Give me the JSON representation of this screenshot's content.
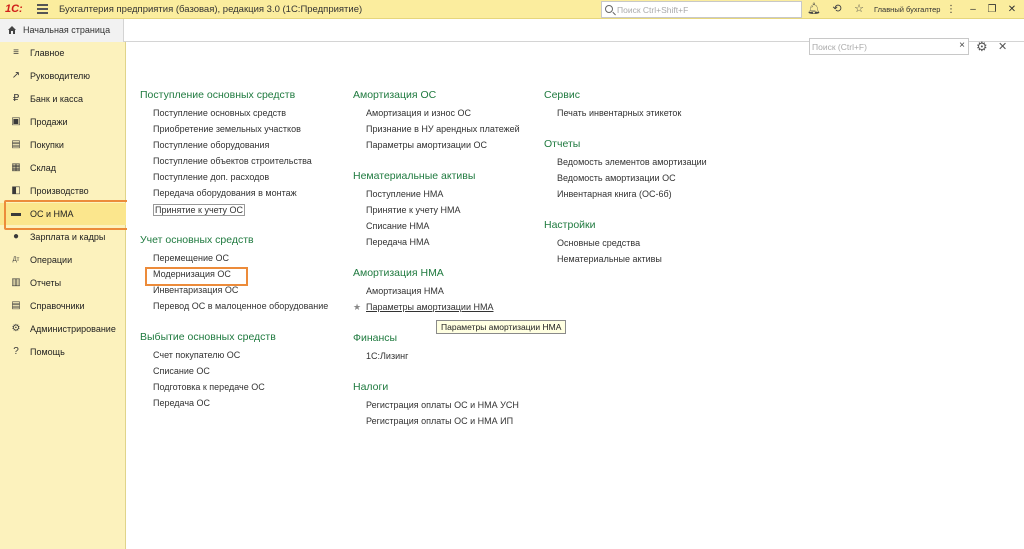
{
  "titlebar": {
    "logo": "1С:",
    "title": "Бухгалтерия предприятия (базовая), редакция 3.0  (1С:Предприятие)",
    "search_placeholder": "Поиск Ctrl+Shift+F",
    "username": "Главный бухгалтер",
    "icons": [
      "bell-icon",
      "history-icon",
      "star-icon",
      "username",
      "more-icon",
      "minimize-icon",
      "maximize-icon",
      "close-icon"
    ]
  },
  "tabstrip": {
    "home_label": "Начальная страница"
  },
  "sidebar": {
    "items": [
      {
        "label": "Главное",
        "icon": "≡"
      },
      {
        "label": "Руководителю",
        "icon": "↗"
      },
      {
        "label": "Банк и касса",
        "icon": "₽"
      },
      {
        "label": "Продажи",
        "icon": "▣"
      },
      {
        "label": "Покупки",
        "icon": "▤"
      },
      {
        "label": "Склад",
        "icon": "▦"
      },
      {
        "label": "Производство",
        "icon": "◧"
      },
      {
        "label": "ОС и НМА",
        "icon": "▬"
      },
      {
        "label": "Зарплата и кадры",
        "icon": "●"
      },
      {
        "label": "Операции",
        "icon": "Дт"
      },
      {
        "label": "Отчеты",
        "icon": "▥"
      },
      {
        "label": "Справочники",
        "icon": "▤"
      },
      {
        "label": "Администрирование",
        "icon": "⚙"
      },
      {
        "label": "Помощь",
        "icon": "?"
      }
    ],
    "active_index": 7
  },
  "main": {
    "search_placeholder": "Поиск (Ctrl+F)",
    "columns": [
      {
        "groups": [
          {
            "title": "Поступление основных средств",
            "links": [
              "Поступление основных средств",
              "Приобретение земельных участков",
              "Поступление оборудования",
              "Поступление объектов строительства",
              "Поступление доп. расходов",
              "Передача оборудования в монтаж",
              "Принятие к учету ОС"
            ]
          },
          {
            "title": "Учет основных средств",
            "links": [
              "Перемещение ОС",
              "Модернизация ОС",
              "Инвентаризация ОС",
              "Перевод ОС в малоценное оборудование"
            ]
          },
          {
            "title": "Выбытие основных средств",
            "links": [
              "Счет покупателю ОС",
              "Списание ОС",
              "Подготовка к передаче ОС",
              "Передача ОС"
            ]
          }
        ]
      },
      {
        "groups": [
          {
            "title": "Амортизация ОС",
            "links": [
              "Амортизация и износ ОС",
              "Признание в НУ арендных платежей",
              "Параметры амортизации ОС"
            ]
          },
          {
            "title": "Нематериальные активы",
            "links": [
              "Поступление НМА",
              "Принятие к учету НМА",
              "Списание НМА",
              "Передача НМА"
            ]
          },
          {
            "title": "Амортизация НМА",
            "links": [
              "Амортизация НМА",
              "Параметры амортизации НМА"
            ]
          },
          {
            "title": "Финансы",
            "links": [
              "1С:Лизинг"
            ]
          },
          {
            "title": "Налоги",
            "links": [
              "Регистрация оплаты ОС и НМА УСН",
              "Регистрация оплаты ОС и НМА ИП"
            ]
          }
        ]
      },
      {
        "groups": [
          {
            "title": "Сервис",
            "links": [
              "Печать инвентарных этикеток"
            ]
          },
          {
            "title": "Отчеты",
            "links": [
              "Ведомость элементов амортизации",
              "Ведомость амортизации ОС",
              "Инвентарная книга (ОС-6б)"
            ]
          },
          {
            "title": "Настройки",
            "links": [
              "Основные средства",
              "Нематериальные активы"
            ]
          }
        ]
      }
    ],
    "tooltip": "Параметры амортизации НМА",
    "star": "★"
  },
  "colors": {
    "titlebar_bg": "#fbed9e",
    "sidebar_bg": "#fcf2bd",
    "group_title": "#1f7a3f",
    "highlight": "#ec8b3a"
  }
}
